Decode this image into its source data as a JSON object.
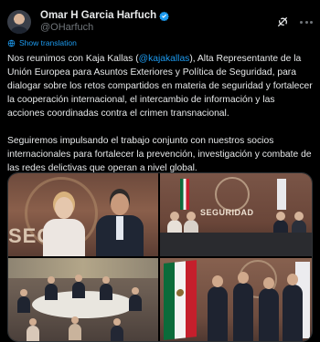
{
  "author": {
    "display_name": "Omar H Garcia Harfuch",
    "handle": "@OHarfuch",
    "verified": true
  },
  "actions": {
    "grok_icon": "grok-icon",
    "more_icon": "more-icon"
  },
  "translate": {
    "label": "Show translation",
    "icon": "globe-icon"
  },
  "tweet": {
    "p1_before": "Nos reunimos con Kaja Kallas (",
    "p1_mention": "@kajakallas",
    "p1_after": "), Alta Representante de la Unión Europea para Asuntos Exteriores y Política de Seguridad, para dialogar sobre los retos compartidos en materia de seguridad y fortalecer la cooperación internacional, el intercambio de información y las acciones coordinadas contra el crimen transnacional.",
    "p2": "Seguiremos impulsando el trabajo conjunto con nuestros socios internacionales para fortalecer la prevención, investigación y combate de las redes delictivas que operan a nivel global."
  },
  "media": {
    "photo1_sign": "SEGUR",
    "photo2_sign": "SEGURIDAD"
  },
  "colors": {
    "accent": "#1d9bf0",
    "text": "#e7e9ea",
    "muted": "#71767b",
    "background": "#000000"
  }
}
